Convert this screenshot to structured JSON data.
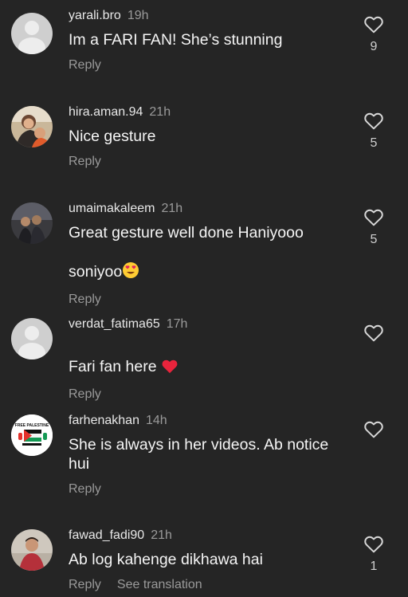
{
  "comments": [
    {
      "username": "yarali.bro",
      "time": "19h",
      "text": "Im a FARI FAN! She’s stunning",
      "reply": "Reply",
      "likes": "9",
      "avatar": "default-avatar"
    },
    {
      "username": "hira.aman.94",
      "time": "21h",
      "text": "Nice gesture",
      "reply": "Reply",
      "likes": "5",
      "avatar": "photo-avatar"
    },
    {
      "username": "umaimakaleem",
      "time": "21h",
      "text": "Great gesture well done Haniyooo\nsoniyoo",
      "emoji": "heart-eyes-emoji",
      "reply": "Reply",
      "likes": "5",
      "avatar": "photo-avatar"
    },
    {
      "username": "verdat_fatima65",
      "time": "17h",
      "text": "Fari fan here",
      "emoji": "red-heart-emoji",
      "reply": "Reply",
      "likes": "",
      "avatar": "default-avatar"
    },
    {
      "username": "farhenakhan",
      "time": "14h",
      "text": "She is always in her videos. Ab notice\nhui",
      "reply": "Reply",
      "likes": "",
      "avatar": "free-palestine-avatar",
      "avatar_text": "FREE PALESTINE"
    },
    {
      "username": "fawad_fadi90",
      "time": "21h",
      "text": "Ab log kahenge dikhawa hai",
      "reply": "Reply",
      "see_translation": "See translation",
      "likes": "1",
      "avatar": "photo-avatar"
    }
  ],
  "colors": {
    "background": "#252525",
    "secondary_text": "#9a9a9a",
    "heart_outline": "#d8d8d8"
  }
}
